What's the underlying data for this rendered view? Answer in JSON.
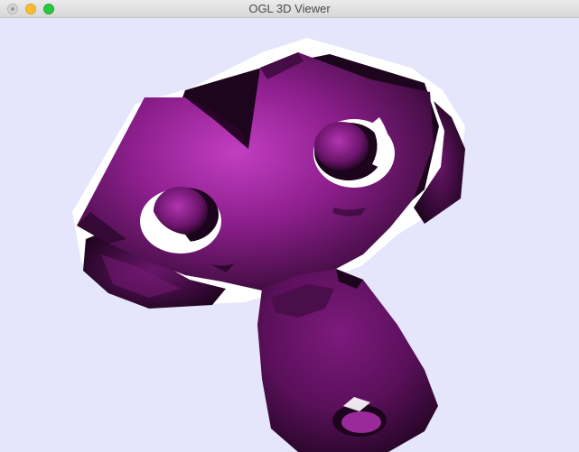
{
  "window": {
    "title": "OGL 3D Viewer"
  },
  "colors": {
    "viewport_background": "#e5e5fb",
    "model_primary": "#8e1f8e",
    "model_dark": "#2a0a2a",
    "model_highlight": "#c040c0",
    "outline": "#ffffff"
  },
  "icons": {
    "close": "close-icon",
    "minimize": "minimize-icon",
    "zoom": "zoom-icon"
  }
}
